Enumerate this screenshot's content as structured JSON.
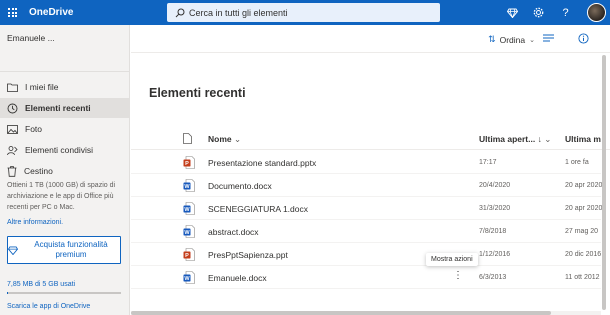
{
  "app": {
    "name": "OneDrive",
    "accent": "#0f64c0"
  },
  "search": {
    "placeholder": "Cerca in tutti gli elementi"
  },
  "header_icons": [
    "diamond-icon",
    "gear-icon",
    "help-icon",
    "avatar"
  ],
  "sidebar": {
    "user": "Emanuele ...",
    "items": [
      {
        "label": "I miei file",
        "icon": "folder-icon",
        "active": false
      },
      {
        "label": "Elementi recenti",
        "icon": "recent-icon",
        "active": true
      },
      {
        "label": "Foto",
        "icon": "photo-icon",
        "active": false
      },
      {
        "label": "Elementi condivisi",
        "icon": "shared-icon",
        "active": false
      },
      {
        "label": "Cestino",
        "icon": "trash-icon",
        "active": false
      }
    ],
    "storage_text": "Ottieni 1 TB (1000 GB) di spazio di archiviazione e le app di Office più recenti per PC o Mac.",
    "more_info": "Altre informazioni.",
    "premium_button": "Acquista funzionalità premium",
    "usage": "7,85 MB di 5 GB usati",
    "usage_fraction": 0.0016,
    "get_apps": "Scarica le app di OneDrive"
  },
  "commandbar": {
    "sort_label": "Ordina"
  },
  "main": {
    "title": "Elementi recenti",
    "columns": {
      "name": "Nome",
      "opened": "Ultima apert...",
      "modified": "Ultima m"
    },
    "files": [
      {
        "name": "Presentazione standard.pptx",
        "type": "pptx",
        "opened": "17:17",
        "modified": "1 ore fa"
      },
      {
        "name": "Documento.docx",
        "type": "docx",
        "opened": "20/4/2020",
        "modified": "20 apr 2020"
      },
      {
        "name": "SCENEGGIATURA 1.docx",
        "type": "docx",
        "opened": "31/3/2020",
        "modified": "20 apr 2020"
      },
      {
        "name": "abstract.docx",
        "type": "docx",
        "opened": "7/8/2018",
        "modified": "27 mag 20"
      },
      {
        "name": "PresPptSapienza.ppt",
        "type": "ppt",
        "opened": "1/12/2016",
        "modified": "20 dic 2016"
      },
      {
        "name": "Emanuele.docx",
        "type": "docx",
        "opened": "6/3/2013",
        "modified": "11 ott 2012"
      }
    ],
    "tooltip": "Mostra azioni"
  }
}
